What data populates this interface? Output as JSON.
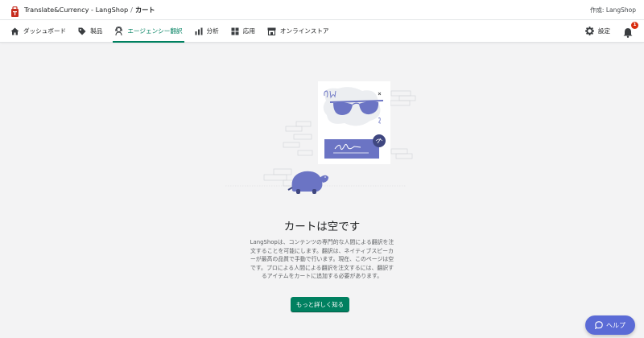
{
  "topbar": {
    "app_name": "Translate&Currency - LangShop",
    "separator": "/",
    "current_page": "カート",
    "made_by": "作成: LangShop"
  },
  "nav": {
    "items": [
      {
        "label": "ダッシュボード",
        "icon": "home-icon",
        "active": false
      },
      {
        "label": "製品",
        "icon": "tag-icon",
        "active": false
      },
      {
        "label": "エージェンシー翻訳",
        "icon": "agent-icon",
        "active": true
      },
      {
        "label": "分析",
        "icon": "bar-chart-icon",
        "active": false
      },
      {
        "label": "応用",
        "icon": "apps-icon",
        "active": false
      },
      {
        "label": "オンラインストア",
        "icon": "store-icon",
        "active": false
      }
    ],
    "settings_label": "設定",
    "notification_count": "1"
  },
  "empty_state": {
    "title": "カートは空です",
    "description": "LangShopは、コンテンツの専門的な人間による翻訳を注文することを可能にします。翻訳は、ネイティブスピーカーが最高の品質で手動で行います。現在、このページは空です。プロによる人間による翻訳を注文するには、翻訳するアイテムをカートに追加する必要があります。",
    "button_label": "もっと詳しく知る"
  },
  "help": {
    "label": "ヘルプ"
  },
  "colors": {
    "accent": "#008060",
    "help_button": "#5b6bd6",
    "illustration": "#6b74c4",
    "badge": "#d82c0d"
  }
}
